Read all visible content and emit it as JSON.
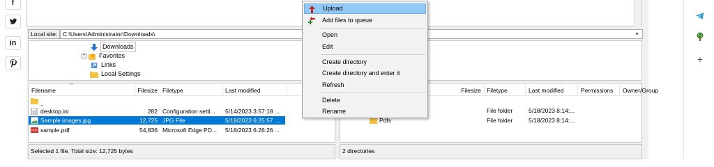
{
  "social": {
    "buttons": [
      {
        "name": "facebook-icon",
        "glyph": "f"
      },
      {
        "name": "twitter-icon",
        "glyph": "🐦"
      },
      {
        "name": "linkedin-icon",
        "glyph": "in"
      },
      {
        "name": "pinterest-icon",
        "glyph": "P"
      }
    ]
  },
  "local_site": {
    "label": "Local site:",
    "path": "C:\\Users\\Administrator\\Downloads\\"
  },
  "tree": {
    "items": [
      "Downloads",
      "Favorites",
      "Links",
      "Local Settings"
    ]
  },
  "local_list": {
    "headers": {
      "filename": "Filename",
      "filesize": "Filesize",
      "filetype": "Filetype",
      "modified": "Last modified"
    },
    "rows": [
      {
        "name": "..",
        "size": "",
        "type": "",
        "modified": ""
      },
      {
        "name": "desktop.ini",
        "size": "282",
        "type": "Configuration setti...",
        "modified": "5/14/2023 3:57:18 ..."
      },
      {
        "name": "Sample images.jpg",
        "size": "12,725",
        "type": "JPG File",
        "modified": "5/18/2023 6:25:57 ..."
      },
      {
        "name": "sample.pdf",
        "size": "54,836",
        "type": "Microsoft Edge PD...",
        "modified": "5/18/2023 6:26:26 ..."
      }
    ],
    "status": "Selected 1 file. Total size: 12,725 bytes"
  },
  "remote_list": {
    "headers": {
      "filesize": "Filesize",
      "filetype": "Filetype",
      "modified": "Last modified",
      "permissions": "Permissions",
      "owner": "Owner/Group"
    },
    "rows": [
      {
        "name": "",
        "type": "File folder",
        "modified": "5/18/2023 8:14:..."
      },
      {
        "name": "Pdfs",
        "type": "File folder",
        "modified": "5/18/2023 8:14:..."
      }
    ],
    "status": "2 directories"
  },
  "context_menu": {
    "items": {
      "upload": "Upload",
      "add_queue": "Add files to queue",
      "open": "Open",
      "edit": "Edit",
      "create_dir": "Create directory",
      "create_dir_enter": "Create directory and enter it",
      "refresh": "Refresh",
      "delete": "Delete",
      "rename": "Rename"
    }
  },
  "colors": {
    "selection": "#0078d7",
    "menu_highlight": "#91c9f7",
    "folder": "#f5c242"
  }
}
